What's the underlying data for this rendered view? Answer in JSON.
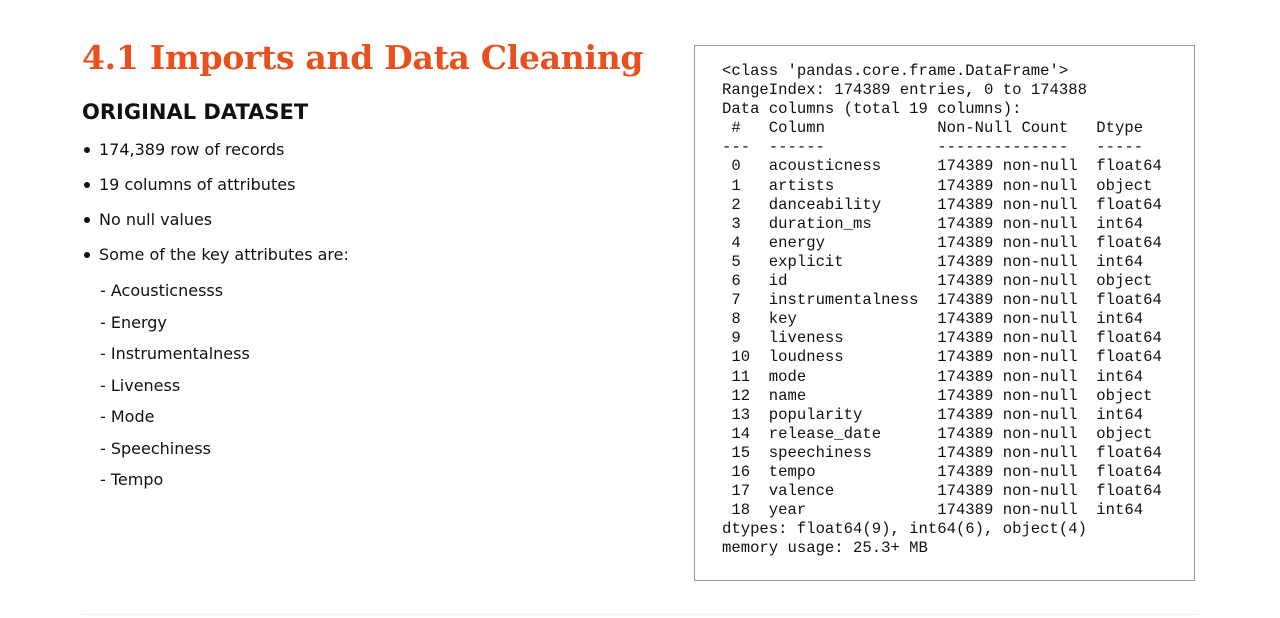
{
  "slide": {
    "title": "4.1 Imports and Data Cleaning",
    "subtitle": "ORIGINAL DATASET",
    "bullets": [
      "174,389 row of records",
      "19 columns of attributes",
      "No null values",
      "Some of the key attributes are:"
    ],
    "key_attributes": [
      "- Acousticnesss",
      "- Energy",
      "- Instrumentalness",
      "- Liveness",
      "- Mode",
      "- Speechiness",
      "- Tempo"
    ]
  },
  "code_output": {
    "lines": [
      "<class 'pandas.core.frame.DataFrame'>",
      "RangeIndex: 174389 entries, 0 to 174388",
      "Data columns (total 19 columns):",
      " #   Column            Non-Null Count   Dtype  ",
      "---  ------            --------------   -----  ",
      " 0   acousticness      174389 non-null  float64",
      " 1   artists           174389 non-null  object ",
      " 2   danceability      174389 non-null  float64",
      " 3   duration_ms       174389 non-null  int64  ",
      " 4   energy            174389 non-null  float64",
      " 5   explicit          174389 non-null  int64  ",
      " 6   id                174389 non-null  object ",
      " 7   instrumentalness  174389 non-null  float64",
      " 8   key               174389 non-null  int64  ",
      " 9   liveness          174389 non-null  float64",
      " 10  loudness          174389 non-null  float64",
      " 11  mode              174389 non-null  int64  ",
      " 12  name              174389 non-null  object ",
      " 13  popularity        174389 non-null  int64  ",
      " 14  release_date      174389 non-null  object ",
      " 15  speechiness       174389 non-null  float64",
      " 16  tempo             174389 non-null  float64",
      " 17  valence           174389 non-null  float64",
      " 18  year              174389 non-null  int64  ",
      "dtypes: float64(9), int64(6), object(4)",
      "memory usage: 25.3+ MB"
    ]
  },
  "colors": {
    "accent": "#e8501e",
    "text": "#111111",
    "box_border": "#9a9a9a",
    "background": "#ffffff"
  }
}
